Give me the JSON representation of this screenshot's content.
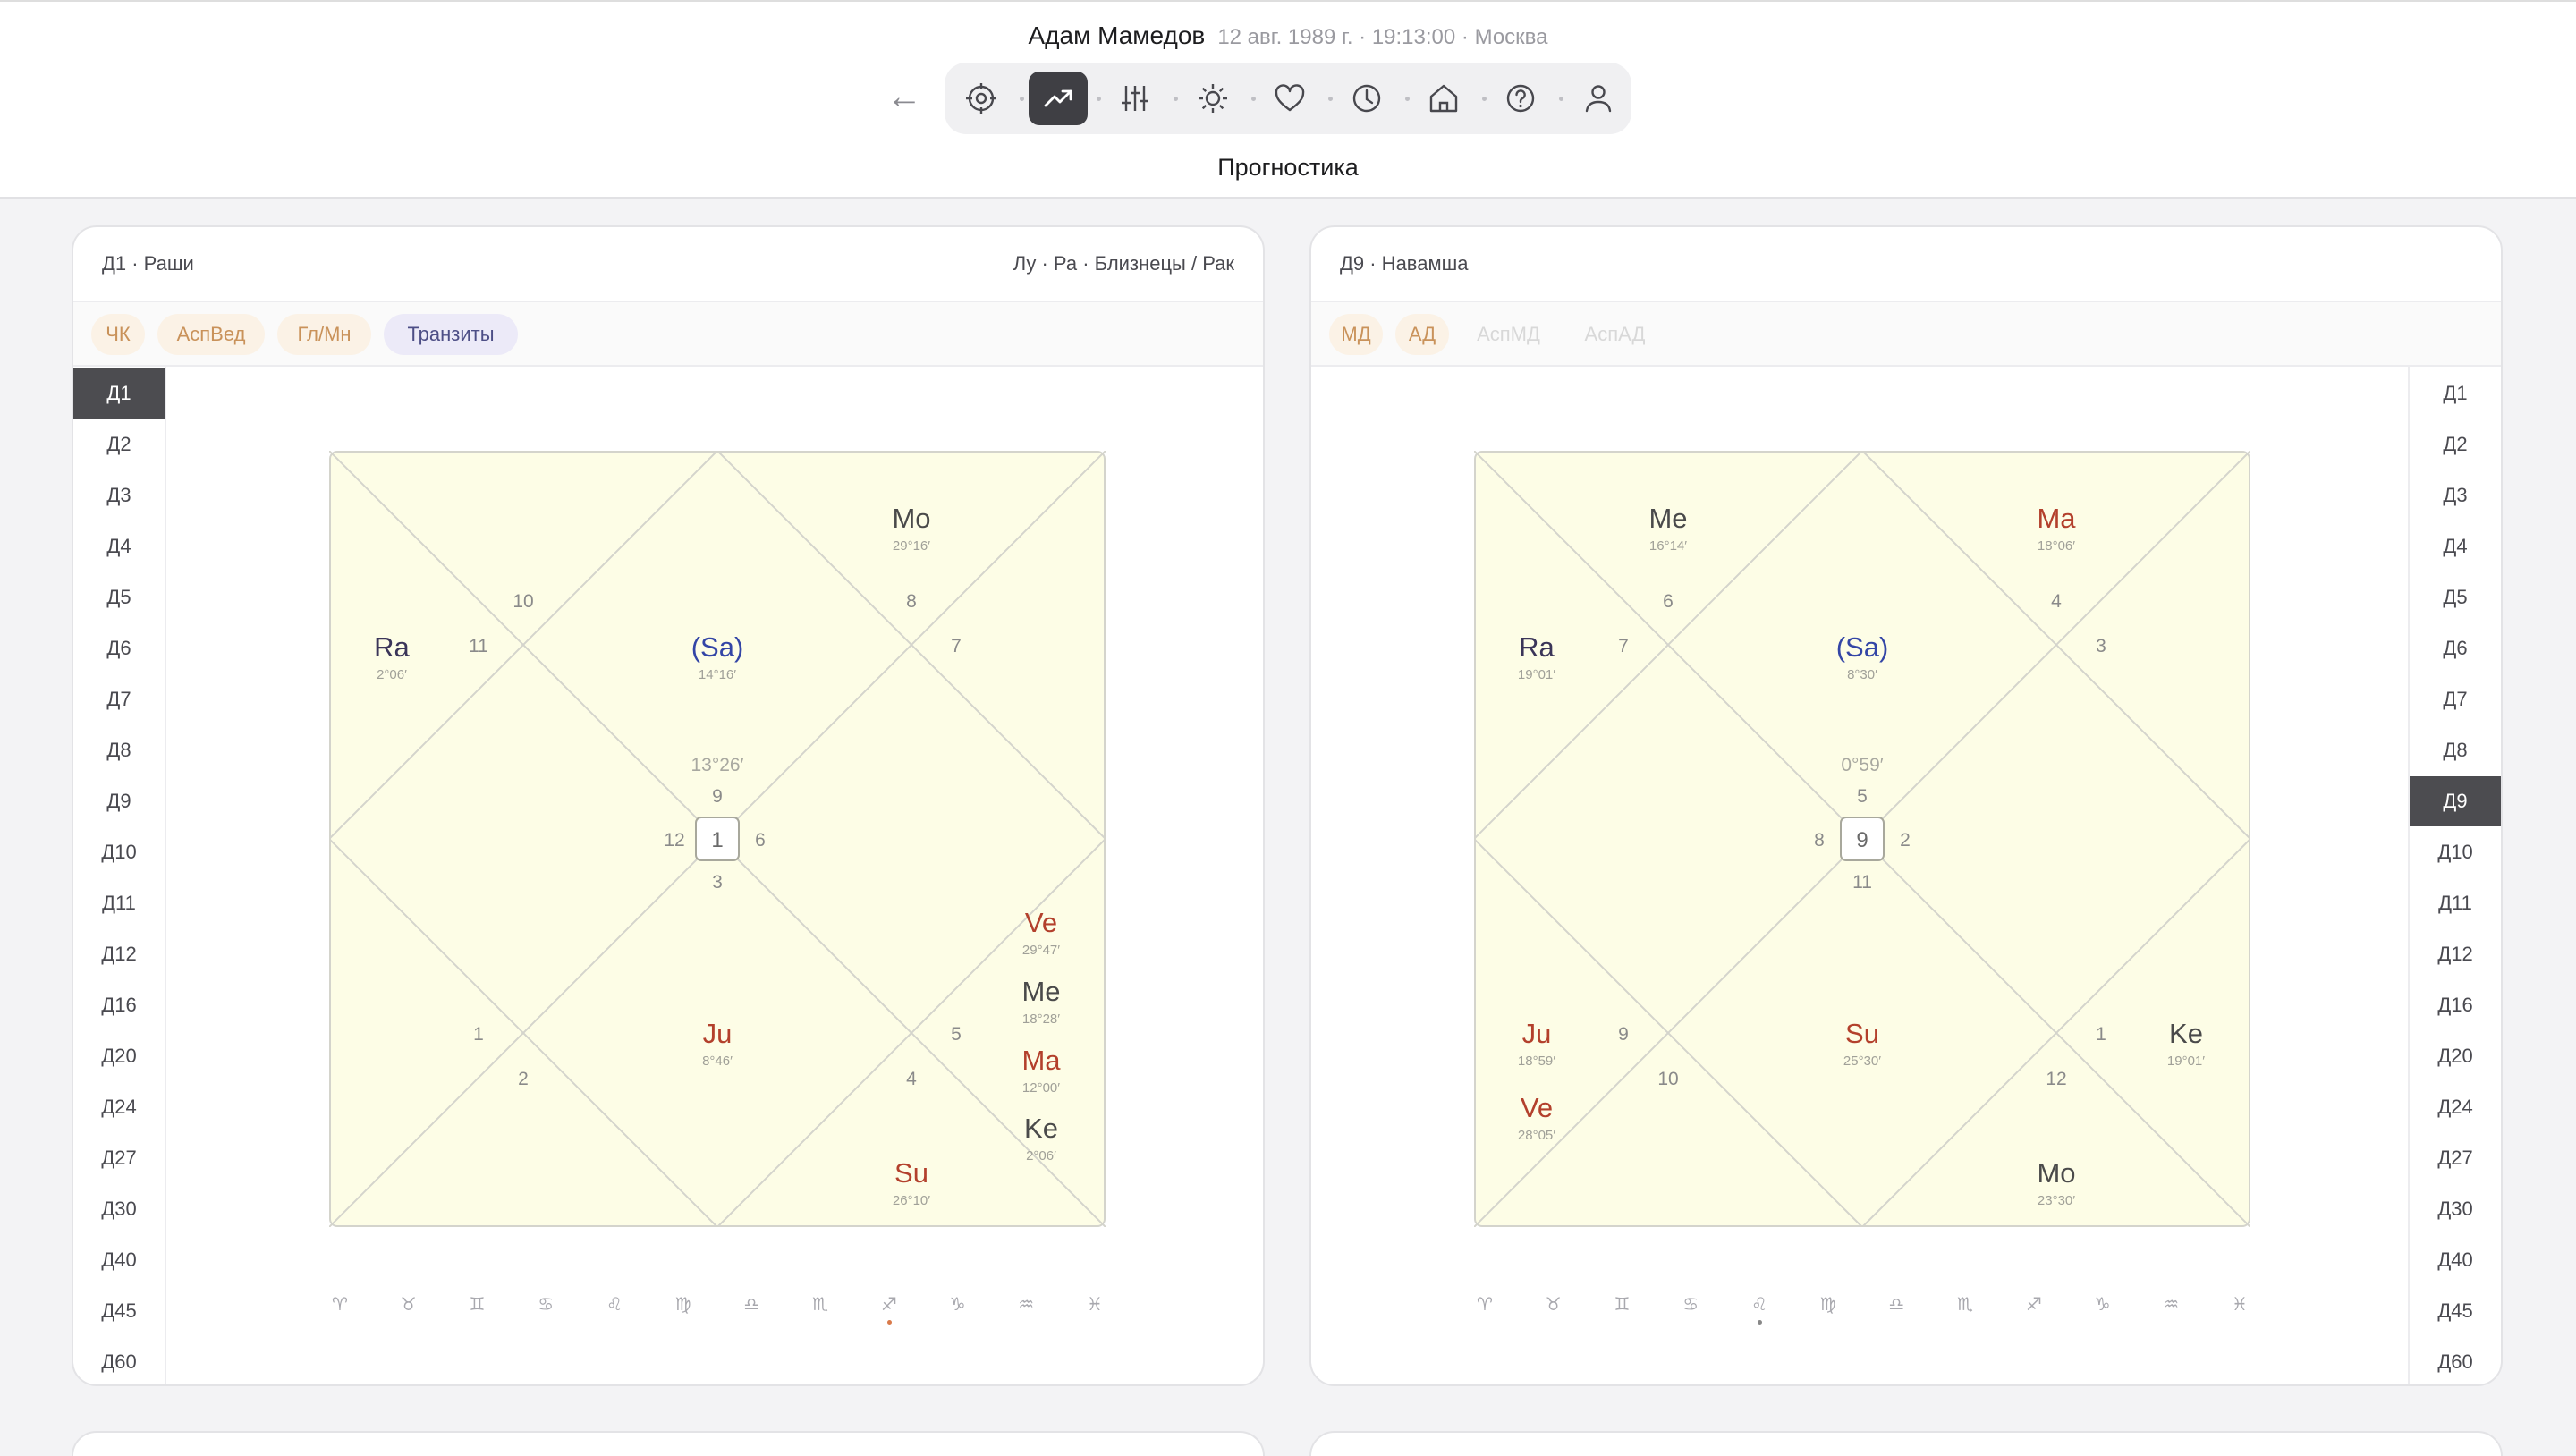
{
  "header": {
    "name": "Адам Мамедов",
    "meta": "12 авг. 1989 г. · 19:13:00 · Москва",
    "back_label": "←",
    "section_title": "Прогностика",
    "toolbar": [
      {
        "icon": "target-icon"
      },
      {
        "icon": "trend-up-icon",
        "active": true
      },
      {
        "icon": "sliders-icon"
      },
      {
        "icon": "sun-icon"
      },
      {
        "icon": "heart-icon"
      },
      {
        "icon": "clock-icon"
      },
      {
        "icon": "home-icon"
      },
      {
        "icon": "help-icon"
      },
      {
        "icon": "user-icon"
      }
    ]
  },
  "colors": {
    "chart_bg": "#fdfde6",
    "line": "#d4d4cc",
    "malefic_red": "#b3402c",
    "benefic_blue": "#3345a6",
    "ra_purple": "#3b3559",
    "dark": "#4a4a4a",
    "transit_dot": "#d97a4a"
  },
  "left": {
    "title": "Д1 · Раши",
    "meta": "Лу · Ра · Близнецы / Рак",
    "chips": [
      {
        "label": "ЧК",
        "style": "orange"
      },
      {
        "label": "АспВед",
        "style": "orange"
      },
      {
        "label": "Гл/Мн",
        "style": "orange"
      },
      {
        "label": "Транзиты",
        "style": "purple"
      }
    ],
    "vnav": [
      "Д1",
      "Д2",
      "Д3",
      "Д4",
      "Д5",
      "Д6",
      "Д7",
      "Д8",
      "Д9",
      "Д10",
      "Д11",
      "Д12",
      "Д16",
      "Д20",
      "Д24",
      "Д27",
      "Д30",
      "Д40",
      "Д45",
      "Д60"
    ],
    "active_nav": "Д1",
    "chart": {
      "center_label": "1",
      "center_degree": "13°26′",
      "center_top": "9",
      "center_left": "12",
      "center_right": "6",
      "center_bottom": "3",
      "house_numbers": [
        "10",
        "11",
        "8",
        "7",
        "1",
        "2",
        "5",
        "4"
      ],
      "planets": [
        {
          "name": "Mo",
          "deg": "29°16′",
          "color": "dark"
        },
        {
          "name": "Ra",
          "deg": "2°06′",
          "color": "ra_purple"
        },
        {
          "name": "(Sa)",
          "deg": "14°16′",
          "color": "benefic_blue"
        },
        {
          "name": "Ve",
          "deg": "29°47′",
          "color": "malefic_red"
        },
        {
          "name": "Me",
          "deg": "18°28′",
          "color": "dark"
        },
        {
          "name": "Ma",
          "deg": "12°00′",
          "color": "malefic_red"
        },
        {
          "name": "Ke",
          "deg": "2°06′",
          "color": "dark"
        },
        {
          "name": "Ju",
          "deg": "8°46′",
          "color": "malefic_red"
        },
        {
          "name": "Su",
          "deg": "26°10′",
          "color": "malefic_red"
        }
      ]
    },
    "signs": [
      "♈",
      "♉",
      "♊",
      "♋",
      "♌",
      "♍",
      "♎",
      "♏",
      "♐",
      "♑",
      "♒",
      "♓"
    ],
    "sign_dot_index": 8
  },
  "right": {
    "title": "Д9 · Навамша",
    "chips": [
      {
        "label": "МД",
        "style": "orange"
      },
      {
        "label": "АД",
        "style": "orange"
      },
      {
        "label": "АспМД",
        "style": "faded"
      },
      {
        "label": "АспАД",
        "style": "faded"
      }
    ],
    "vnav": [
      "Д1",
      "Д2",
      "Д3",
      "Д4",
      "Д5",
      "Д6",
      "Д7",
      "Д8",
      "Д9",
      "Д10",
      "Д11",
      "Д12",
      "Д16",
      "Д20",
      "Д24",
      "Д27",
      "Д30",
      "Д40",
      "Д45",
      "Д60"
    ],
    "active_nav": "Д9",
    "chart": {
      "center_label": "9",
      "center_degree": "0°59′",
      "center_top": "5",
      "center_left": "8",
      "center_right": "2",
      "center_bottom": "11",
      "house_numbers": [
        "6",
        "7",
        "4",
        "3",
        "9",
        "10",
        "1",
        "12"
      ],
      "planets": [
        {
          "name": "Me",
          "deg": "16°14′",
          "color": "dark"
        },
        {
          "name": "Ma",
          "deg": "18°06′",
          "color": "malefic_red"
        },
        {
          "name": "Ra",
          "deg": "19°01′",
          "color": "ra_purple"
        },
        {
          "name": "(Sa)",
          "deg": "8°30′",
          "color": "benefic_blue"
        },
        {
          "name": "Ju",
          "deg": "18°59′",
          "color": "malefic_red"
        },
        {
          "name": "Ve",
          "deg": "28°05′",
          "color": "malefic_red"
        },
        {
          "name": "Su",
          "deg": "25°30′",
          "color": "malefic_red"
        },
        {
          "name": "Ke",
          "deg": "19°01′",
          "color": "dark"
        },
        {
          "name": "Mo",
          "deg": "23°30′",
          "color": "dark"
        }
      ]
    },
    "signs": [
      "♈",
      "♉",
      "♊",
      "♋",
      "♌",
      "♍",
      "♎",
      "♏",
      "♐",
      "♑",
      "♒",
      "♓"
    ],
    "sign_dot_index": 4
  }
}
